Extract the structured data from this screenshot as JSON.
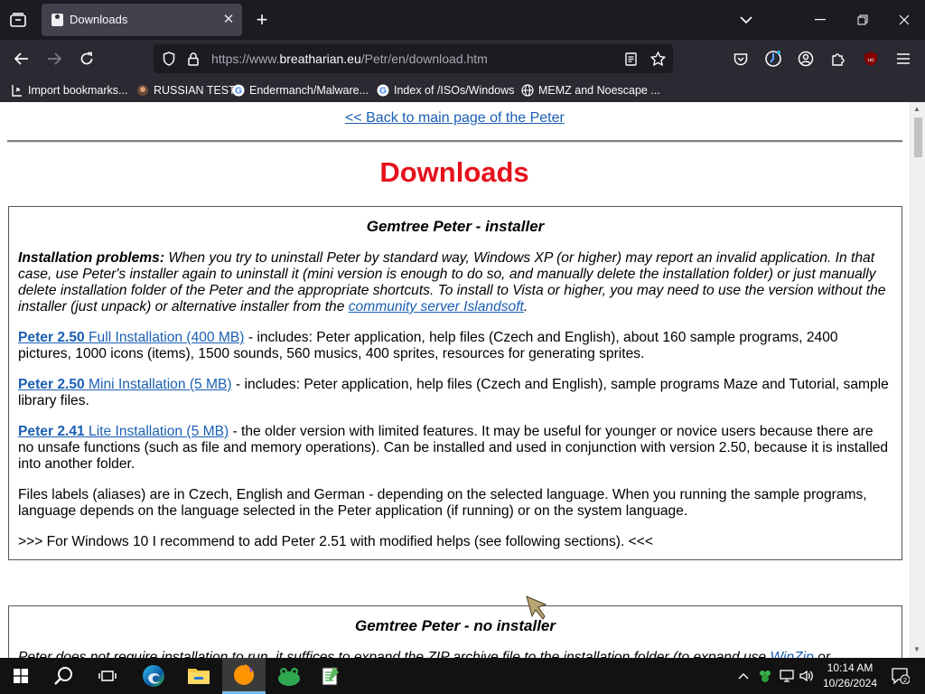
{
  "browser": {
    "tab_title": "Downloads",
    "url_prefix": "https://www.",
    "url_host": "breatharian.eu",
    "url_path": "/Petr/en/download.htm"
  },
  "bookmarks": [
    {
      "label": "Import bookmarks...",
      "icon": "import-icon"
    },
    {
      "label": "RUSSIAN TEST",
      "icon": "bookmark-favicon"
    },
    {
      "label": "Endermanch/Malware...",
      "icon": "google-icon"
    },
    {
      "label": "Index of /ISOs/Windows",
      "icon": "google-icon"
    },
    {
      "label": "MEMZ and Noescape ...",
      "icon": "globe-icon"
    }
  ],
  "page": {
    "back_link": "<< Back to main page of the Peter",
    "title": "Downloads",
    "box1": {
      "heading": "Gemtree Peter - installer",
      "problems_label": "Installation problems:",
      "problems_text": " When you try to uninstall Peter by standard way, Windows XP (or higher) may report an invalid application. In that case, use Peter's installer again to uninstall it (mini version is enough to do so, and manually delete the installation folder) or just manually delete installation folder of the Peter and the appropriate shortcuts. To install to Vista or higher, you may need to use the version without the installer (just unpack) or alternative installer from the ",
      "problems_link": "community server Islandsoft",
      "problems_end": ".",
      "full_bold": "Peter 2.50",
      "full_link": " Full Installation (400 MB)",
      "full_text": " - includes: Peter application, help files (Czech and English), about 160 sample programs, 2400 pictures, 1000 icons (items), 1500 sounds, 560 musics, 400 sprites, resources for generating sprites.",
      "mini_bold": "Peter 2.50",
      "mini_link": " Mini Installation (5 MB)",
      "mini_text": " - includes: Peter application, help files (Czech and English), sample programs Maze and Tutorial, sample library files.",
      "lite_bold": "Peter 2.41",
      "lite_link": " Lite Installation (5 MB)",
      "lite_text": " - the older version with limited features. It may be useful for younger or novice users because there are no unsafe functions (such as file and memory operations). Can be installed and used in conjunction with version 2.50, because it is installed into another folder.",
      "labels_text": "Files labels (aliases) are in Czech, English and German - depending on the selected language. When you running the sample programs, language depends on the language selected in the Peter application (if running) or on the system language.",
      "win10_text": ">>> For Windows 10 I recommend to add Peter 2.51 with modified helps (see following sections). <<<"
    },
    "box2": {
      "heading": "Gemtree Peter - no installer",
      "text": "Peter does not require installation to run, it suffices to expand the ZIP archive file to the installation folder (to expand use ",
      "link": "WinZip",
      "text_end": " or"
    }
  },
  "taskbar": {
    "time": "10:14 AM",
    "date": "10/26/2024",
    "notification_count": "2"
  }
}
